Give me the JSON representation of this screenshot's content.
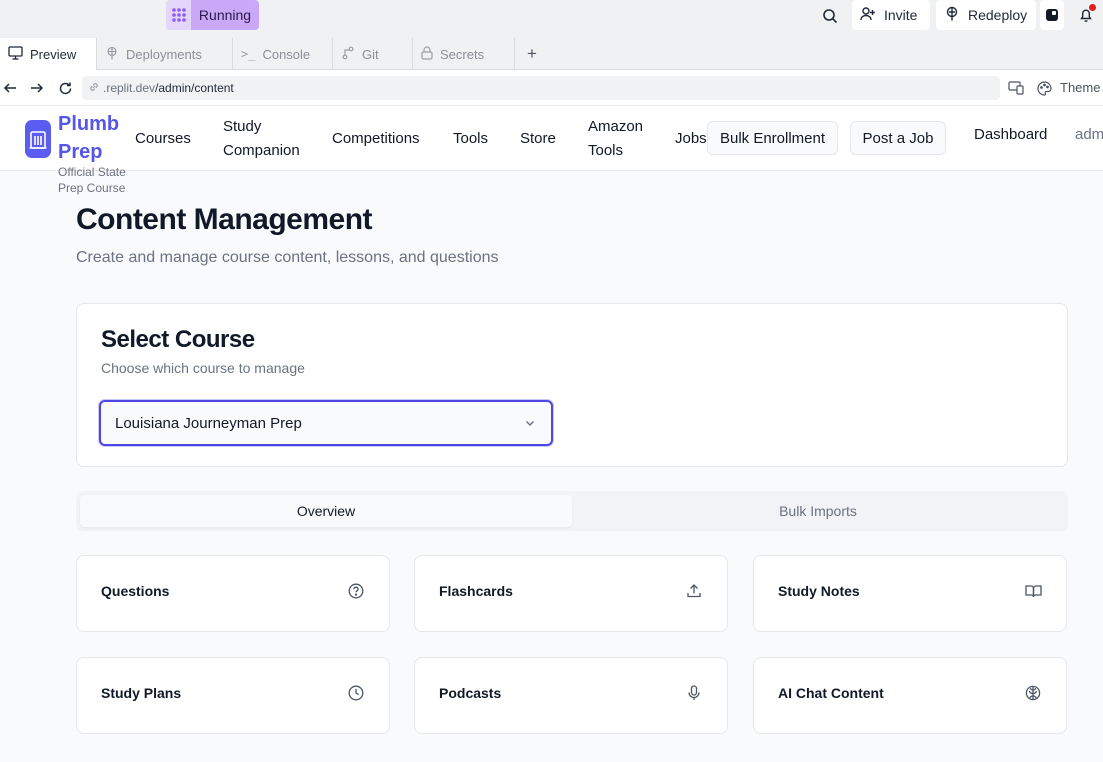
{
  "replit": {
    "run_status": "Running",
    "invite_label": "Invite",
    "redeploy_label": "Redeploy",
    "tabs": [
      {
        "label": "Preview",
        "icon": "monitor-icon"
      },
      {
        "label": "Deployments",
        "icon": "deploy-icon"
      },
      {
        "label": "Console",
        "icon": "terminal-icon"
      },
      {
        "label": "Git",
        "icon": "git-icon"
      },
      {
        "label": "Secrets",
        "icon": "lock-icon"
      }
    ],
    "new_tab_label": "+",
    "url_host": ".replit.dev",
    "url_path": "/admin/content",
    "theme_label": "Theme"
  },
  "app": {
    "brand_name": "Plumb Prep",
    "brand_tagline": "Official State Prep Course",
    "nav": [
      "Courses",
      "Study Companion",
      "Competitions",
      "Tools",
      "Store",
      "Amazon Tools",
      "Jobs"
    ],
    "bulk_enrollment_label": "Bulk Enrollment",
    "post_job_label": "Post a Job",
    "dashboard_label": "Dashboard",
    "admin_label": "admin"
  },
  "main": {
    "title": "Content Management",
    "subtitle": "Create and manage course content, lessons, and questions",
    "course_card": {
      "title": "Select Course",
      "subtitle": "Choose which course to manage",
      "selected_course": "Louisiana Journeyman Prep"
    },
    "tabs": [
      "Overview",
      "Bulk Imports"
    ],
    "active_tab": "Overview",
    "tiles": [
      {
        "label": "Questions",
        "icon": "help-circle-icon"
      },
      {
        "label": "Flashcards",
        "icon": "upload-icon"
      },
      {
        "label": "Study Notes",
        "icon": "book-open-icon"
      },
      {
        "label": "Study Plans",
        "icon": "clock-icon"
      },
      {
        "label": "Podcasts",
        "icon": "microphone-icon"
      },
      {
        "label": "AI Chat Content",
        "icon": "brain-icon"
      }
    ]
  },
  "colors": {
    "brand": "#5456e8",
    "running_pill": "#c9a8f7",
    "select_focus": "#4f46e5"
  }
}
